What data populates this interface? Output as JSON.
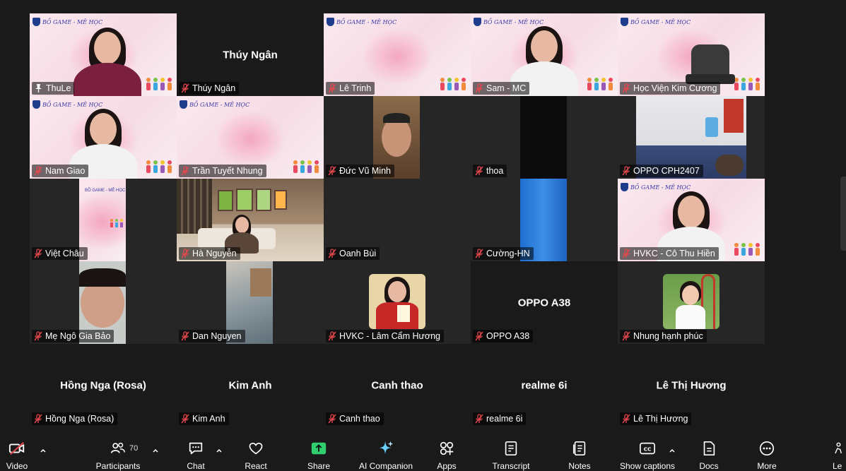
{
  "participants": [
    {
      "name": "ThuLe",
      "bigname": "",
      "kind": "video-speaker",
      "pinned": true
    },
    {
      "name": "Thúy Ngân",
      "bigname": "Thúy Ngân",
      "kind": "name-only",
      "pinned": false
    },
    {
      "name": "Lê Trinh",
      "bigname": "",
      "kind": "pink-empty",
      "pinned": false
    },
    {
      "name": "Sam - MC",
      "bigname": "",
      "kind": "video",
      "pinned": false
    },
    {
      "name": "Học Viện Kim Cương",
      "bigname": "",
      "kind": "pink-chair",
      "pinned": false
    },
    {
      "name": "Nam Giao",
      "bigname": "",
      "kind": "video",
      "pinned": false
    },
    {
      "name": "Trần Tuyết Nhung",
      "bigname": "",
      "kind": "pink-empty",
      "pinned": false
    },
    {
      "name": "Đức Vũ Minh",
      "bigname": "",
      "kind": "portrait",
      "pinned": false
    },
    {
      "name": "thoa",
      "bigname": "",
      "kind": "dark-portrait",
      "pinned": false
    },
    {
      "name": "OPPO CPH2407",
      "bigname": "",
      "kind": "room",
      "pinned": false
    },
    {
      "name": "Việt Châu",
      "bigname": "",
      "kind": "narrow-pink",
      "pinned": false
    },
    {
      "name": "Hà Nguyễn",
      "bigname": "",
      "kind": "living-room",
      "pinned": false
    },
    {
      "name": "Oanh Bùi",
      "bigname": "",
      "kind": "empty",
      "pinned": false
    },
    {
      "name": "Cường-HN",
      "bigname": "",
      "kind": "blue-portrait",
      "pinned": false
    },
    {
      "name": "HVKC - Cô Thu Hiền",
      "bigname": "",
      "kind": "video",
      "pinned": false
    },
    {
      "name": "Mẹ Ngô Gia Bảo",
      "bigname": "",
      "kind": "portrait-face",
      "pinned": false
    },
    {
      "name": "Dan Nguyen",
      "bigname": "",
      "kind": "portrait-cloth",
      "pinned": false
    },
    {
      "name": "HVKC - Lâm Cẩm Hương",
      "bigname": "",
      "kind": "avatar-red",
      "pinned": false
    },
    {
      "name": "OPPO A38",
      "bigname": "OPPO A38",
      "kind": "name-only",
      "pinned": false
    },
    {
      "name": "Nhung hạnh phúc",
      "bigname": "",
      "kind": "avatar-child",
      "pinned": false
    },
    {
      "name": "Hồng Nga (Rosa)",
      "bigname": "Hồng Nga (Rosa)",
      "kind": "name-only",
      "pinned": false
    },
    {
      "name": "Kim Anh",
      "bigname": "Kim Anh",
      "kind": "name-only",
      "pinned": false
    },
    {
      "name": "Canh thao",
      "bigname": "Canh thao",
      "kind": "name-only",
      "pinned": false
    },
    {
      "name": "realme 6i",
      "bigname": "realme 6i",
      "kind": "name-only",
      "pinned": false
    },
    {
      "name": "Lê Thị Hương",
      "bigname": "Lê Thị Hương",
      "kind": "name-only",
      "pinned": false
    }
  ],
  "logo_text": "BỒ GAME - MÊ HỌC",
  "toolbar": {
    "video": "Video",
    "participants": "Participants",
    "participants_count": "70",
    "chat": "Chat",
    "react": "React",
    "share": "Share",
    "ai": "AI Companion",
    "apps": "Apps",
    "transcript": "Transcript",
    "notes": "Notes",
    "captions": "Show captions",
    "docs": "Docs",
    "more": "More",
    "leave": "Le"
  },
  "colors": {
    "background": "#1a1a1a",
    "active_speaker": "#2fce6f",
    "share_green": "#2fce6f",
    "muted_red": "#e5484d"
  }
}
